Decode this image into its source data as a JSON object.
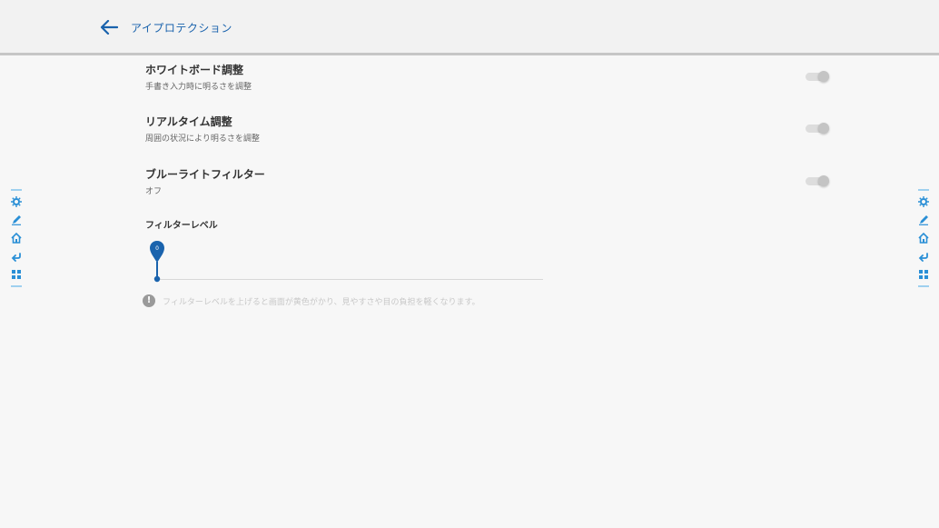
{
  "header": {
    "title": "アイプロテクション"
  },
  "settings": [
    {
      "title": "ホワイトボード調整",
      "subtitle": "手書き入力時に明るさを調整"
    },
    {
      "title": "リアルタイム調整",
      "subtitle": "周囲の状況により明るさを調整"
    },
    {
      "title": "ブルーライトフィルター",
      "subtitle": "オフ"
    }
  ],
  "filter": {
    "label": "フィルターレベル",
    "value": "0",
    "level_fraction": 0,
    "note": "フィルターレベルを上げると画面が黄色がかり、見やすさや目の負担を軽くなります。"
  },
  "colors": {
    "accent": "#1a63ad",
    "sidebar_icon": "#2a8fd6"
  },
  "icons": {
    "back": "arrow-left-icon",
    "side": [
      "settings-icon",
      "pen-icon",
      "home-icon",
      "return-icon",
      "apps-icon"
    ]
  }
}
